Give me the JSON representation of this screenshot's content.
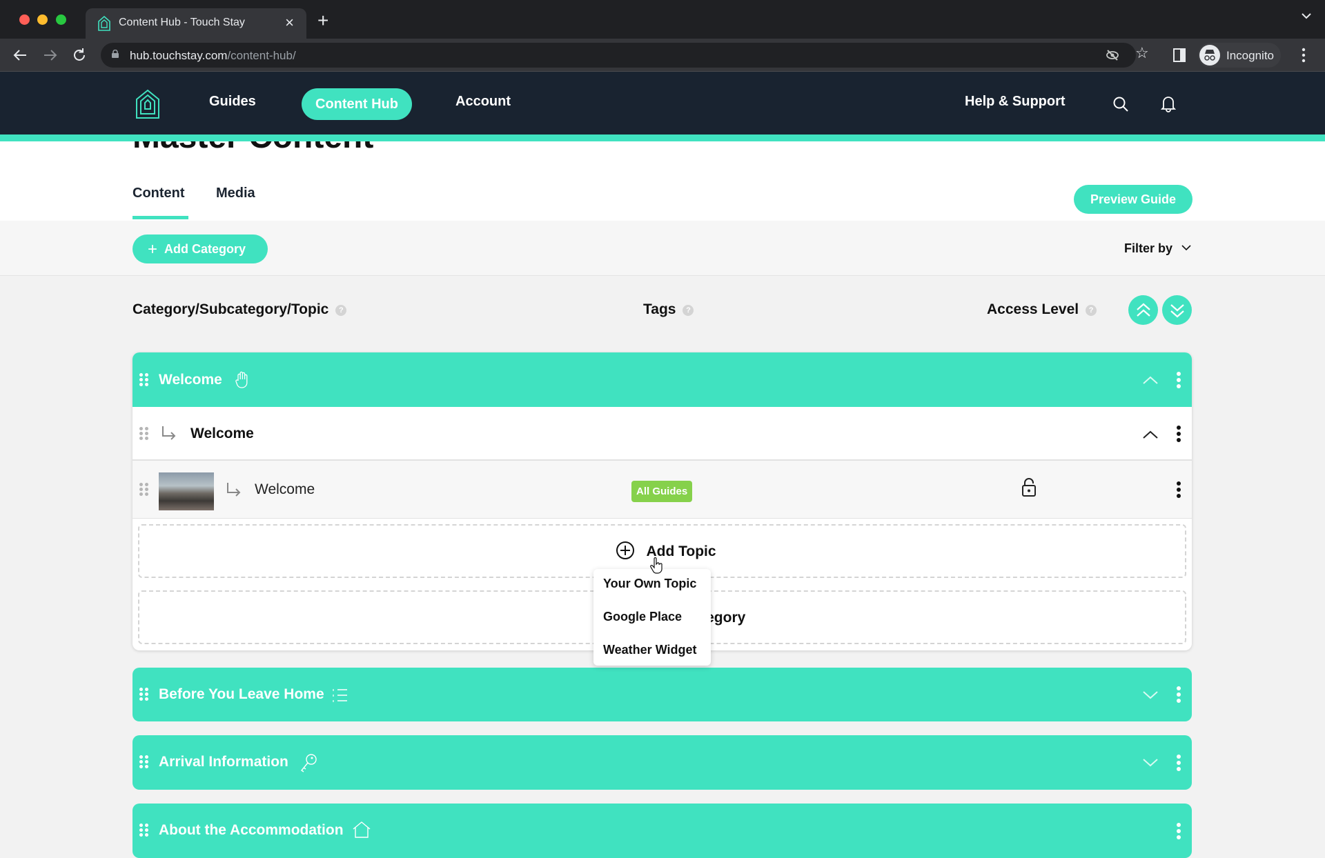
{
  "browser": {
    "tab_title": "Content Hub - Touch Stay",
    "url_host": "hub.touchstay.com",
    "url_path": "/content-hub/",
    "profile_label": "Incognito"
  },
  "nav": {
    "links": [
      "Guides",
      "Content Hub",
      "Account"
    ],
    "active": "Content Hub",
    "help_label": "Help & Support"
  },
  "page": {
    "title": "Master Content",
    "tabs": [
      "Content",
      "Media"
    ],
    "active_tab": "Content",
    "preview_label": "Preview Guide",
    "add_category_label": "Add Category",
    "filter_label": "Filter by"
  },
  "columns": {
    "category": "Category/Subcategory/Topic",
    "tags": "Tags",
    "access": "Access Level"
  },
  "categories": [
    {
      "title": "Welcome",
      "icon": "hand-icon",
      "expanded": true,
      "subcategories": [
        {
          "title": "Welcome",
          "expanded": true,
          "topics": [
            {
              "title": "Welcome",
              "tag": "All Guides",
              "access": "unlocked"
            }
          ]
        }
      ],
      "add_topic_label": "Add Topic",
      "add_subcategory_label": "Add Subcategory"
    },
    {
      "title": "Before You Leave Home",
      "icon": "list-icon",
      "expanded": false
    },
    {
      "title": "Arrival Information",
      "icon": "key-icon",
      "expanded": false
    },
    {
      "title": "About the Accommodation",
      "icon": "house-icon",
      "expanded": false
    }
  ],
  "add_topic_menu": [
    "Your Own Topic",
    "Google Place",
    "Weather Widget"
  ],
  "colors": {
    "brand": "#40e2c0",
    "nav_bg": "#192330",
    "tag_green": "#86d14b"
  }
}
